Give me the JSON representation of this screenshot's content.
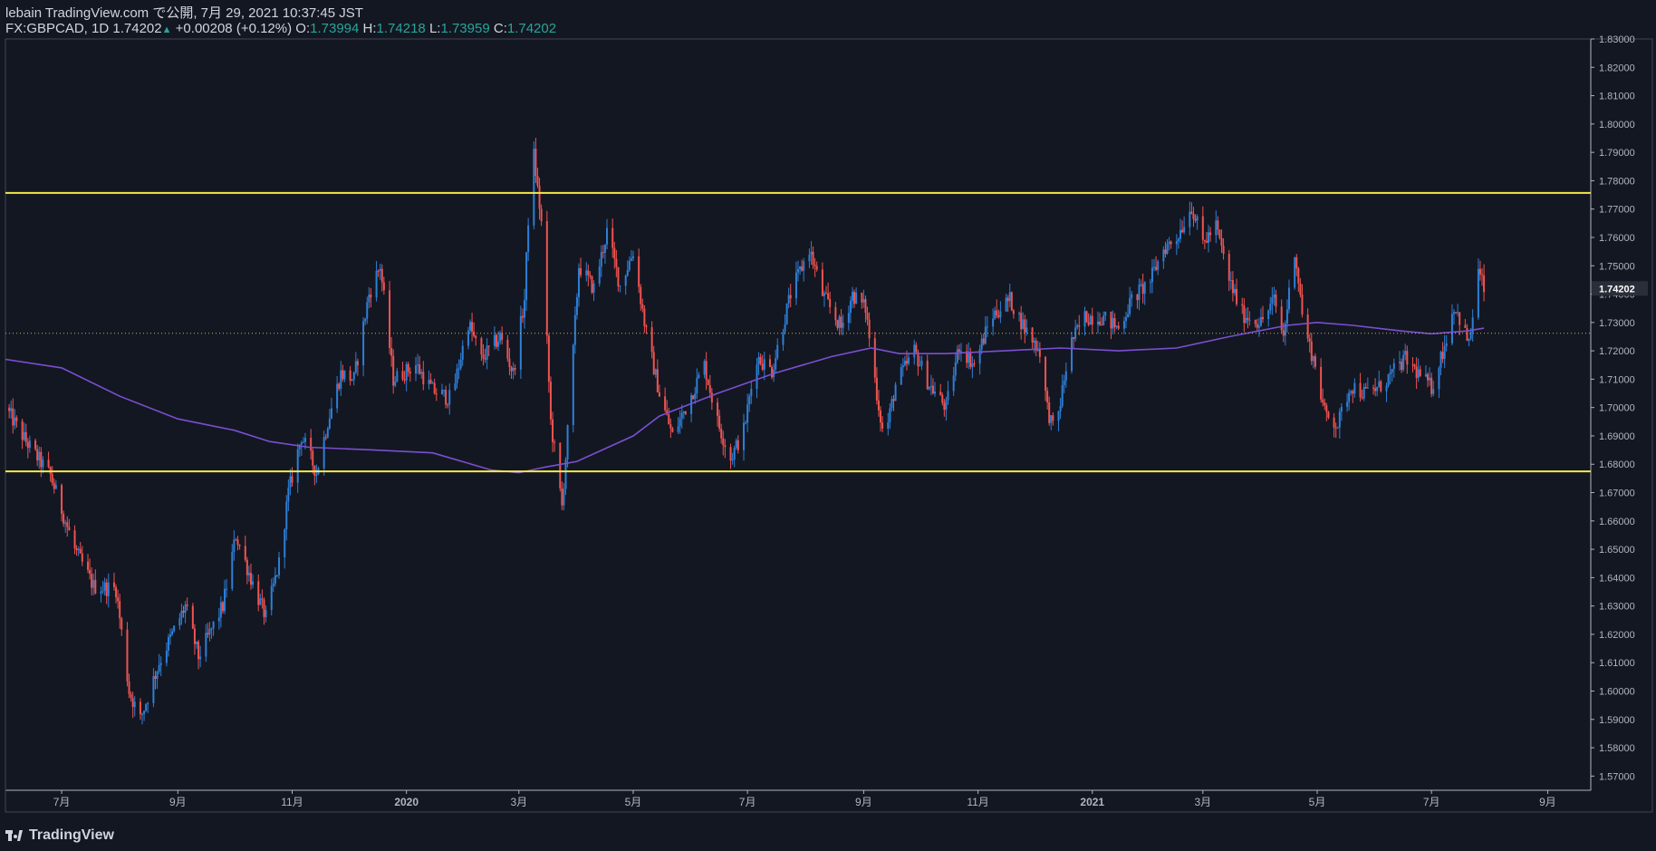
{
  "header": {
    "publish_line": "lebain TradingView.com で公開, 7月 29, 2021 10:37:45 JST",
    "symbol": "FX:GBPCAD, 1D",
    "last": "1.74202",
    "change": "+0.00208 (+0.12%)",
    "o_label": "O:",
    "o_val": "1.73994",
    "h_label": "H:",
    "h_val": "1.74218",
    "l_label": "L:",
    "l_val": "1.73959",
    "c_label": "C:",
    "c_val": "1.74202"
  },
  "footer": {
    "brand": "TradingView"
  },
  "colors": {
    "background": "#131722",
    "up": "#2e7fd6",
    "down": "#ef5350",
    "ma": "#7b4fd0",
    "resistance": "#f5e94a",
    "current": "#ffeb3b"
  },
  "chart_data": {
    "type": "candlestick",
    "symbol": "FX:GBPCAD",
    "interval": "1D",
    "y_axis": {
      "min": 1.565,
      "max": 1.83,
      "ticks": [
        "1.57000",
        "1.58000",
        "1.59000",
        "1.60000",
        "1.61000",
        "1.62000",
        "1.63000",
        "1.64000",
        "1.65000",
        "1.66000",
        "1.67000",
        "1.68000",
        "1.69000",
        "1.70000",
        "1.71000",
        "1.72000",
        "1.73000",
        "1.74000",
        "1.75000",
        "1.76000",
        "1.77000",
        "1.78000",
        "1.79000",
        "1.80000",
        "1.81000",
        "1.82000",
        "1.83000"
      ],
      "last_price_label": "1.74202",
      "last_price": 1.742
    },
    "x_axis": {
      "labels": [
        "7月",
        "9月",
        "11月",
        "2020",
        "3月",
        "5月",
        "7月",
        "9月",
        "11月",
        "2021",
        "3月",
        "5月",
        "7月",
        "9月"
      ],
      "start": "2019-06-01",
      "end": "2021-09-24"
    },
    "horizontal_lines": [
      {
        "value": 1.7757,
        "style": "solid"
      },
      {
        "value": 1.6775,
        "style": "solid"
      },
      {
        "value": 1.7262,
        "style": "dotted"
      }
    ],
    "close_path": [
      [
        "2019-06-01",
        1.7
      ],
      [
        "2019-06-12",
        1.688
      ],
      [
        "2019-06-25",
        1.676
      ],
      [
        "2019-07-08",
        1.65
      ],
      [
        "2019-07-18",
        1.637
      ],
      [
        "2019-07-30",
        1.636
      ],
      [
        "2019-08-06",
        1.6
      ],
      [
        "2019-08-12",
        1.59
      ],
      [
        "2019-08-22",
        1.61
      ],
      [
        "2019-09-05",
        1.63
      ],
      [
        "2019-09-12",
        1.612
      ],
      [
        "2019-09-25",
        1.63
      ],
      [
        "2019-10-02",
        1.655
      ],
      [
        "2019-10-12",
        1.636
      ],
      [
        "2019-10-18",
        1.626
      ],
      [
        "2019-10-25",
        1.645
      ],
      [
        "2019-10-30",
        1.67
      ],
      [
        "2019-11-06",
        1.69
      ],
      [
        "2019-11-14",
        1.677
      ],
      [
        "2019-11-20",
        1.695
      ],
      [
        "2019-11-27",
        1.712
      ],
      [
        "2019-12-04",
        1.71
      ],
      [
        "2019-12-12",
        1.74
      ],
      [
        "2019-12-18",
        1.75
      ],
      [
        "2019-12-25",
        1.71
      ],
      [
        "2020-01-06",
        1.715
      ],
      [
        "2020-01-15",
        1.706
      ],
      [
        "2020-01-25",
        1.703
      ],
      [
        "2020-02-03",
        1.73
      ],
      [
        "2020-02-10",
        1.717
      ],
      [
        "2020-02-20",
        1.725
      ],
      [
        "2020-02-27",
        1.712
      ],
      [
        "2020-03-04",
        1.738
      ],
      [
        "2020-03-08",
        1.795
      ],
      [
        "2020-03-13",
        1.765
      ],
      [
        "2020-03-18",
        1.695
      ],
      [
        "2020-03-24",
        1.665
      ],
      [
        "2020-03-28",
        1.7
      ],
      [
        "2020-04-02",
        1.75
      ],
      [
        "2020-04-10",
        1.742
      ],
      [
        "2020-04-17",
        1.762
      ],
      [
        "2020-04-24",
        1.743
      ],
      [
        "2020-05-01",
        1.755
      ],
      [
        "2020-05-08",
        1.726
      ],
      [
        "2020-05-15",
        1.705
      ],
      [
        "2020-05-22",
        1.69
      ],
      [
        "2020-05-29",
        1.7
      ],
      [
        "2020-06-08",
        1.715
      ],
      [
        "2020-06-15",
        1.695
      ],
      [
        "2020-06-22",
        1.682
      ],
      [
        "2020-06-29",
        1.692
      ],
      [
        "2020-07-06",
        1.718
      ],
      [
        "2020-07-14",
        1.713
      ],
      [
        "2020-07-24",
        1.74
      ],
      [
        "2020-08-03",
        1.756
      ],
      [
        "2020-08-10",
        1.74
      ],
      [
        "2020-08-20",
        1.728
      ],
      [
        "2020-08-26",
        1.74
      ],
      [
        "2020-09-02",
        1.735
      ],
      [
        "2020-09-08",
        1.705
      ],
      [
        "2020-09-12",
        1.688
      ],
      [
        "2020-09-18",
        1.708
      ],
      [
        "2020-09-28",
        1.72
      ],
      [
        "2020-10-06",
        1.708
      ],
      [
        "2020-10-15",
        1.7
      ],
      [
        "2020-10-22",
        1.722
      ],
      [
        "2020-10-30",
        1.715
      ],
      [
        "2020-11-08",
        1.732
      ],
      [
        "2020-11-18",
        1.738
      ],
      [
        "2020-11-26",
        1.728
      ],
      [
        "2020-12-04",
        1.72
      ],
      [
        "2020-12-08",
        1.7
      ],
      [
        "2020-12-12",
        1.69
      ],
      [
        "2020-12-20",
        1.722
      ],
      [
        "2020-12-28",
        1.732
      ],
      [
        "2021-01-06",
        1.732
      ],
      [
        "2021-01-15",
        1.728
      ],
      [
        "2021-01-22",
        1.738
      ],
      [
        "2021-02-01",
        1.745
      ],
      [
        "2021-02-08",
        1.756
      ],
      [
        "2021-02-15",
        1.76
      ],
      [
        "2021-02-23",
        1.771
      ],
      [
        "2021-03-01",
        1.758
      ],
      [
        "2021-03-08",
        1.764
      ],
      [
        "2021-03-15",
        1.745
      ],
      [
        "2021-03-22",
        1.733
      ],
      [
        "2021-04-01",
        1.73
      ],
      [
        "2021-04-08",
        1.738
      ],
      [
        "2021-04-13",
        1.725
      ],
      [
        "2021-04-19",
        1.756
      ],
      [
        "2021-04-24",
        1.728
      ],
      [
        "2021-04-30",
        1.715
      ],
      [
        "2021-05-05",
        1.698
      ],
      [
        "2021-05-12",
        1.694
      ],
      [
        "2021-05-19",
        1.708
      ],
      [
        "2021-05-26",
        1.705
      ],
      [
        "2021-06-03",
        1.707
      ],
      [
        "2021-06-10",
        1.712
      ],
      [
        "2021-06-17",
        1.717
      ],
      [
        "2021-06-24",
        1.712
      ],
      [
        "2021-07-01",
        1.707
      ],
      [
        "2021-07-08",
        1.722
      ],
      [
        "2021-07-13",
        1.736
      ],
      [
        "2021-07-17",
        1.73
      ],
      [
        "2021-07-21",
        1.722
      ],
      [
        "2021-07-26",
        1.748
      ],
      [
        "2021-07-29",
        1.742
      ]
    ],
    "ma_path": [
      [
        "2019-06-01",
        1.717
      ],
      [
        "2019-07-01",
        1.714
      ],
      [
        "2019-08-01",
        1.704
      ],
      [
        "2019-09-01",
        1.696
      ],
      [
        "2019-10-01",
        1.692
      ],
      [
        "2019-10-20",
        1.688
      ],
      [
        "2019-11-10",
        1.686
      ],
      [
        "2019-12-15",
        1.685
      ],
      [
        "2020-01-15",
        1.684
      ],
      [
        "2020-02-15",
        1.678
      ],
      [
        "2020-03-01",
        1.677
      ],
      [
        "2020-03-15",
        1.679
      ],
      [
        "2020-04-01",
        1.681
      ],
      [
        "2020-05-01",
        1.69
      ],
      [
        "2020-05-15",
        1.697
      ],
      [
        "2020-06-15",
        1.705
      ],
      [
        "2020-07-15",
        1.712
      ],
      [
        "2020-08-15",
        1.718
      ],
      [
        "2020-09-05",
        1.721
      ],
      [
        "2020-09-20",
        1.719
      ],
      [
        "2020-10-15",
        1.719
      ],
      [
        "2020-11-15",
        1.72
      ],
      [
        "2020-12-15",
        1.721
      ],
      [
        "2021-01-15",
        1.72
      ],
      [
        "2021-02-15",
        1.721
      ],
      [
        "2021-03-15",
        1.725
      ],
      [
        "2021-04-15",
        1.729
      ],
      [
        "2021-05-01",
        1.73
      ],
      [
        "2021-05-20",
        1.729
      ],
      [
        "2021-06-15",
        1.727
      ],
      [
        "2021-07-01",
        1.726
      ],
      [
        "2021-07-20",
        1.727
      ],
      [
        "2021-07-29",
        1.728
      ]
    ]
  }
}
